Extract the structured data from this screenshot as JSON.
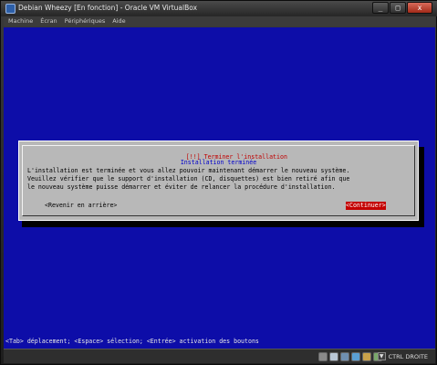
{
  "window": {
    "title": "Debian Wheezy [En fonction] - Oracle VM VirtualBox",
    "minimize": "_",
    "maximize": "□",
    "close": "x"
  },
  "menu": [
    "Machine",
    "Écran",
    "Périphériques",
    "Aide"
  ],
  "dialog": {
    "title": "[!!] Terminer l'installation",
    "subtitle": "Installation terminée",
    "body": "L'installation est terminée et vous allez pouvoir maintenant démarrer le nouveau système.\nVeuillez vérifier que le support d'installation (CD, disquettes) est bien retiré afin que\nle nouveau système puisse démarrer et éviter de relancer la procédure d'installation.",
    "back_button": "<Revenir en arrière>",
    "continue_button": "<Continuer>"
  },
  "help_line": "<Tab> déplacement; <Espace> sélection; <Entrée> activation des boutons",
  "statusbar": {
    "host_key": "CTRL DROITE",
    "icons": [
      "hdd-icon",
      "cd-icon",
      "usb-icon",
      "network-icon",
      "shared-folder-icon",
      "mouse-integration-icon"
    ],
    "icon_colors": [
      "#8a8a8a",
      "#b9c7d6",
      "#6f8fb0",
      "#5a9fd4",
      "#c9a24a",
      "#7aa86a"
    ]
  }
}
